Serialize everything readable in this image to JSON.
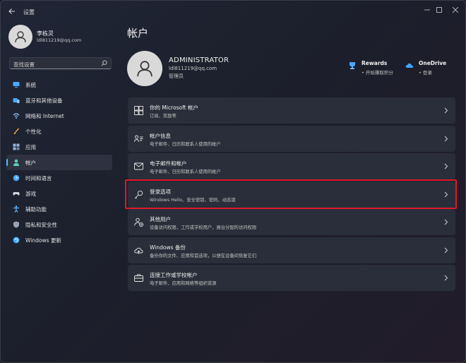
{
  "window": {
    "title": "设置"
  },
  "profile": {
    "name": "李栋灵",
    "email": "ldl811219@qq.com"
  },
  "search": {
    "placeholder": "查找设置"
  },
  "nav": {
    "items": [
      {
        "label": "系统",
        "icon": "monitor-icon",
        "color": "#4aa8ff"
      },
      {
        "label": "蓝牙和其他设备",
        "icon": "bluetooth-icon",
        "color": "#4aa8ff"
      },
      {
        "label": "网络和 Internet",
        "icon": "wifi-icon",
        "color": "#8ec7ff"
      },
      {
        "label": "个性化",
        "icon": "brush-icon",
        "color": "#f0a45a"
      },
      {
        "label": "应用",
        "icon": "apps-icon",
        "color": "#9ab4d8"
      },
      {
        "label": "帐户",
        "icon": "person-icon",
        "color": "#5fd0b8",
        "active": true
      },
      {
        "label": "时间和语言",
        "icon": "globe-clock-icon",
        "color": "#4aa8ff"
      },
      {
        "label": "游戏",
        "icon": "gamepad-icon",
        "color": "#cfd3dc"
      },
      {
        "label": "辅助功能",
        "icon": "accessibility-icon",
        "color": "#59b7ff"
      },
      {
        "label": "隐私和安全性",
        "icon": "shield-icon",
        "color": "#9aa3b5"
      },
      {
        "label": "Windows 更新",
        "icon": "update-icon",
        "color": "#3fa6ff"
      }
    ]
  },
  "main": {
    "title": "帐户",
    "account": {
      "name": "ADMINISTRATOR",
      "email": "ldl811219@qq.com",
      "role": "管理员"
    },
    "services": {
      "rewards": {
        "title": "Rewards",
        "subtitle": "• 开始赚取积分"
      },
      "onedrive": {
        "title": "OneDrive",
        "subtitle": "• 登录"
      }
    },
    "cards": [
      {
        "title": "你的 Microsoft 帐户",
        "subtitle": "订阅、奖励等",
        "icon": "windows-logo-icon"
      },
      {
        "title": "帐户信息",
        "subtitle": "电子邮件、日历和联系人使用的帐户",
        "icon": "account-info-icon"
      },
      {
        "title": "电子邮件和帐户",
        "subtitle": "电子邮件、日历和联系人使用的帐户",
        "icon": "mail-icon"
      },
      {
        "title": "登录选项",
        "subtitle": "Windows Hello、安全密钥、密码、动态锁",
        "icon": "key-icon",
        "highlighted": true
      },
      {
        "title": "其他用户",
        "subtitle": "设备访问权限，工作或学校用户，展台分配的访问权限",
        "icon": "add-user-icon"
      },
      {
        "title": "Windows 备份",
        "subtitle": "备份你的文件、应用和首选项，以便在设备间恢复它们",
        "icon": "backup-icon"
      },
      {
        "title": "连接工作或学校帐户",
        "subtitle": "电子邮件、应用和网络等组织资源",
        "icon": "briefcase-icon"
      }
    ]
  },
  "colors": {
    "accent": "#4cc2ff",
    "highlight": "#e0182a"
  }
}
